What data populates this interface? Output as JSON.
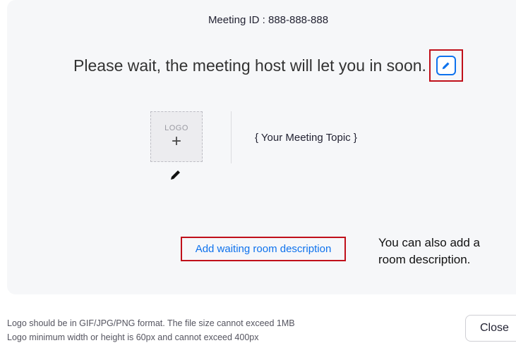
{
  "waiting_room": {
    "meeting_id": "Meeting ID : 888-888-888",
    "wait_message": "Please wait, the meeting host will let you in soon.",
    "logo_label": "LOGO",
    "logo_plus": "+",
    "topic": "{ Your Meeting Topic }",
    "add_description_label": "Add waiting room description"
  },
  "annotation": {
    "line1": "You can also add a",
    "line2": "room description."
  },
  "footer": {
    "format_note": "Logo should be in GIF/JPG/PNG format. The file size cannot exceed 1MB",
    "size_note": "Logo minimum width or height is 60px and cannot exceed 400px",
    "close_label": "Close"
  },
  "colors": {
    "accent": "#0e72ed",
    "highlight": "#c0101a",
    "panel_background": "#f6f7f9"
  },
  "icons": {
    "edit_title": "pencil-icon",
    "edit_logo": "pencil-icon"
  }
}
